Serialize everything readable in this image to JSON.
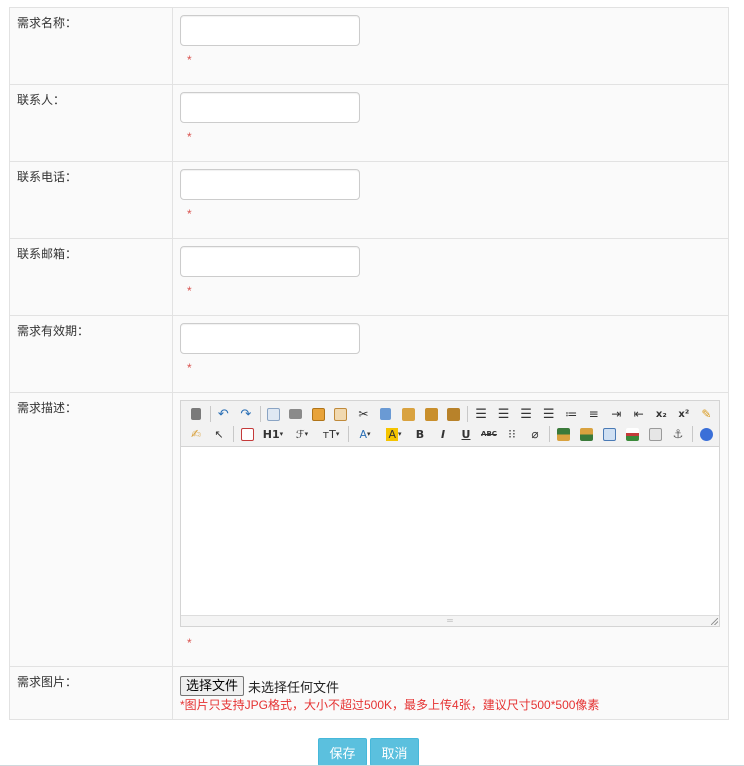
{
  "form": {
    "required_mark": "*",
    "fields": [
      {
        "label": "需求名称：",
        "value": ""
      },
      {
        "label": "联系人：",
        "value": ""
      },
      {
        "label": "联系电话：",
        "value": ""
      },
      {
        "label": "联系邮箱：",
        "value": ""
      },
      {
        "label": "需求有效期：",
        "value": ""
      }
    ],
    "description": {
      "label": "需求描述：",
      "toolbar_row1_icons": [
        "source-icon",
        "undo-icon",
        "redo-icon",
        "preview-icon",
        "print-icon",
        "template-icon",
        "code-icon",
        "cut-icon",
        "copy-icon",
        "paste-icon",
        "paste-text-icon",
        "paste-word-icon",
        "align-left-icon",
        "align-center-icon",
        "align-right-icon",
        "justify-icon",
        "ordered-list-icon",
        "unordered-list-icon",
        "indent-icon",
        "outdent-icon",
        "subscript-icon",
        "superscript-icon",
        "clear-format-icon"
      ],
      "toolbar_row2_icons": [
        "quick-format-icon",
        "select-all-icon",
        "fullscreen-icon",
        "heading-icon",
        "font-family-icon",
        "font-size-icon",
        "font-color-icon",
        "highlight-color-icon",
        "bold-icon",
        "italic-icon",
        "underline-icon",
        "strikethrough-icon",
        "line-height-icon",
        "remove-format-icon",
        "image-icon",
        "multi-image-icon",
        "table-icon",
        "hr-icon",
        "pagebreak-icon",
        "anchor-icon",
        "help-icon"
      ],
      "toolbar_labels": {
        "heading": "H1",
        "font_family": "ℱ",
        "font_size": "тT",
        "font_color": "A",
        "highlight": "A",
        "bold": "B",
        "italic": "I",
        "underline": "U",
        "strikethrough": "ABC",
        "subscript": "x₂",
        "superscript": "x²"
      }
    },
    "image": {
      "label": "需求图片：",
      "choose_button": "选择文件",
      "file_status": "未选择任何文件",
      "hint": "*图片只支持JPG格式，大小不超过500K，最多上传4张，建议尺寸500*500像素"
    }
  },
  "actions": {
    "save_label": "保存",
    "cancel_label": "取消"
  },
  "colors": {
    "accent_button": "#5bc0de",
    "required": "#d9534f",
    "hint_text": "#e53333",
    "border": "#e2e2e2"
  }
}
